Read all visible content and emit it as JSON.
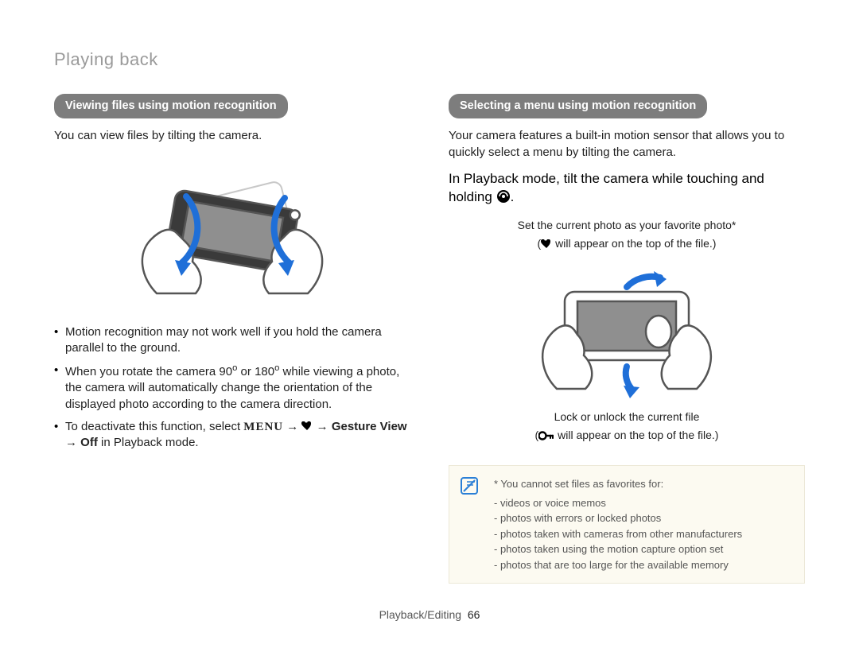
{
  "breadcrumb": "Playing back",
  "left": {
    "heading": "Viewing files using motion recognition",
    "lead": "You can view files by tilting the camera.",
    "bullets": {
      "b1": "Motion recognition may not work well if you hold the camera parallel to the ground.",
      "b2_pre": "When you rotate the camera 90",
      "b2_mid": " or 180",
      "b2_post": " while viewing a photo, the camera will automatically change the orientation of the displayed photo according to the camera direction.",
      "b3_pre": "To deactivate this function, select ",
      "b3_menu": "MENU",
      "b3_arrow1": " → ",
      "b3_arrow2": " → ",
      "b3_gesture": "Gesture View",
      "b3_arrow3": " → ",
      "b3_off": "Off",
      "b3_post": " in Playback mode."
    }
  },
  "right": {
    "heading": "Selecting a menu using motion recognition",
    "lead": "Your camera features a built-in motion sensor that allows you to quickly select a menu by tilting the camera.",
    "instruction_pre": "In Playback mode, tilt the camera while touching and holding ",
    "instruction_post": ".",
    "callout_top": "Set the current photo as your favorite photo*",
    "callout_top_sub_pre": "(",
    "callout_top_sub_post": " will appear on the top of the file.)",
    "callout_bot": "Lock or unlock the current file",
    "callout_bot_sub_pre": "(",
    "callout_bot_sub_post": " will appear on the top of the file.)",
    "note": {
      "title": "* You cannot set files as favorites for:",
      "items": [
        "videos or voice memos",
        "photos with errors or locked photos",
        "photos taken with cameras from other manufacturers",
        "photos taken using the motion capture option set",
        "photos that are too large for the available memory"
      ]
    }
  },
  "footer": {
    "section": "Playback/Editing",
    "page": "66"
  }
}
